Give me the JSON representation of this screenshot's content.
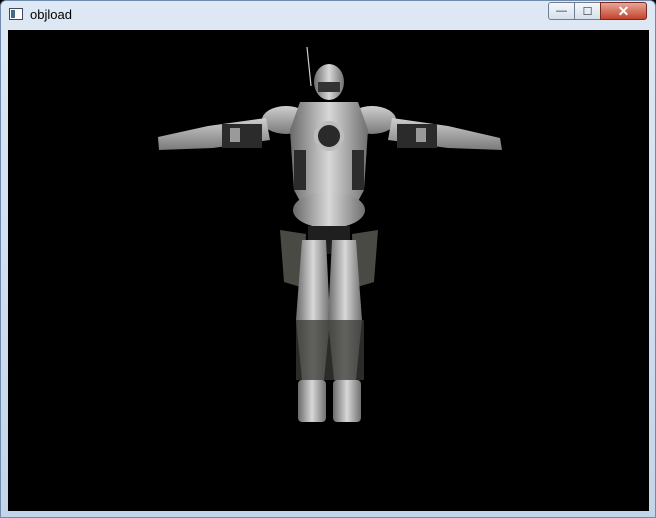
{
  "window": {
    "title": "objload",
    "controls": {
      "minimize": "—",
      "maximize": "☐",
      "close": "✕"
    }
  },
  "viewport": {
    "background": "#000000",
    "model": "armored-humanoid-figure"
  }
}
